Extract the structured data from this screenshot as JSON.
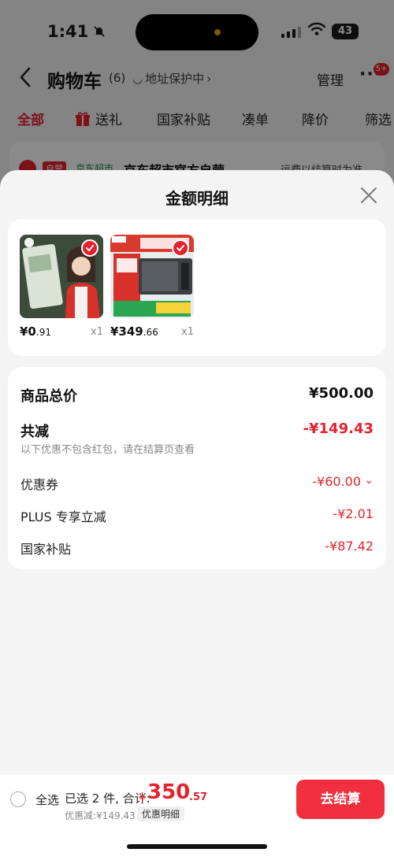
{
  "status": {
    "time": "1:41",
    "battery": "43"
  },
  "nav": {
    "title": "购物车",
    "count": "(6)",
    "location": "地址保护中",
    "manage": "管理",
    "badge": "5+"
  },
  "tabs": [
    "全部",
    "送礼",
    "国家补贴",
    "凑单",
    "降价",
    "筛选"
  ],
  "store": {
    "tag": "自营",
    "sub": "京东超市",
    "name": "京东超市官方自营",
    "shipping": "运费以结算时为准"
  },
  "sheet": {
    "title": "金额明细"
  },
  "products": [
    {
      "price_int": "¥0",
      "price_dec": ".91",
      "qty": "x1"
    },
    {
      "price_int": "¥349",
      "price_dec": ".66",
      "qty": "x1"
    }
  ],
  "breakdown": {
    "total_label": "商品总价",
    "total_value": "¥500.00",
    "discount_label": "共减",
    "discount_value": "-¥149.43",
    "discount_note": "以下优惠不包含红包，请在结算页查看",
    "coupon_label": "优惠券",
    "coupon_value": "-¥60.00",
    "plus_label": "PLUS 专享立减",
    "plus_value": "-¥2.01",
    "subsidy_label": "国家补贴",
    "subsidy_value": "-¥87.42"
  },
  "bottom": {
    "select_all": "全选",
    "selected": "已选 2 件, 合计:",
    "currency": "¥",
    "total_int": "350",
    "total_dec": ".57",
    "saved": "优惠减:¥149.43",
    "detail": "优惠明细",
    "checkout": "去结算"
  },
  "colors": {
    "accent": "#e5212d",
    "checkout": "#f22f3e"
  }
}
